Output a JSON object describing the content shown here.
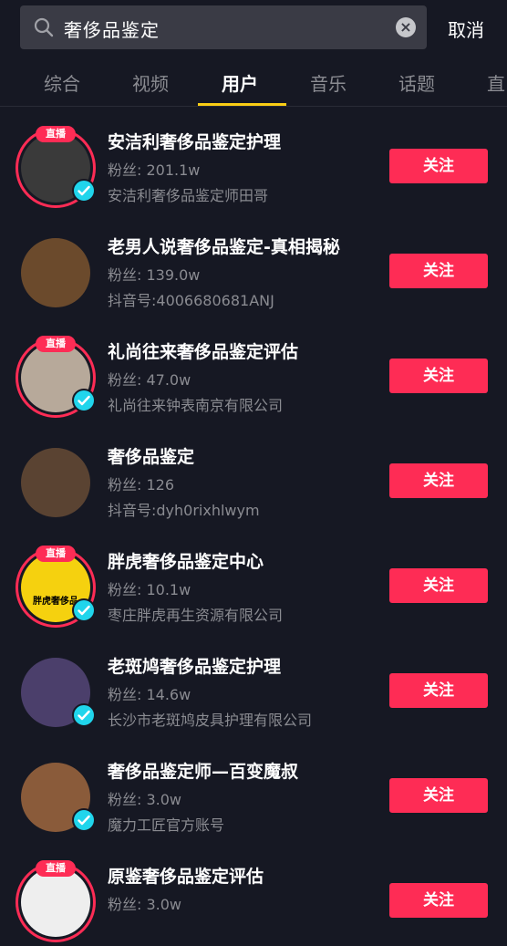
{
  "search": {
    "query": "奢侈品鉴定",
    "cancel_label": "取消"
  },
  "tabs": [
    {
      "label": "综合"
    },
    {
      "label": "视频"
    },
    {
      "label": "用户"
    },
    {
      "label": "音乐"
    },
    {
      "label": "话题"
    },
    {
      "label": "直"
    }
  ],
  "live_badge": "直播",
  "users": [
    {
      "name": "安洁利奢侈品鉴定护理",
      "fans": "粉丝: 201.1w",
      "desc": "安洁利奢侈品鉴定师田哥",
      "follow_label": "关注",
      "live": true,
      "verified": true,
      "avatar_color": "#3a3a3a"
    },
    {
      "name": "老男人说奢侈品鉴定-真相揭秘",
      "fans": "粉丝: 139.0w",
      "desc": "抖音号:4006680681ANJ",
      "follow_label": "关注",
      "live": false,
      "verified": false,
      "avatar_color": "#6b4a2c"
    },
    {
      "name": "礼尚往来奢侈品鉴定评估",
      "fans": "粉丝: 47.0w",
      "desc": "礼尚往来钟表南京有限公司",
      "follow_label": "关注",
      "live": true,
      "verified": true,
      "avatar_color": "#b7a99a"
    },
    {
      "name": "奢侈品鉴定",
      "fans": "粉丝: 126",
      "desc": "抖音号:dyh0rixhlwym",
      "follow_label": "关注",
      "live": false,
      "verified": false,
      "avatar_color": "#5a4332"
    },
    {
      "name": "胖虎奢侈品鉴定中心",
      "fans": "粉丝: 10.1w",
      "desc": "枣庄胖虎再生资源有限公司",
      "follow_label": "关注",
      "live": true,
      "verified": true,
      "avatar_color": "#f5d10f",
      "avatar_text": "胖虎奢侈品"
    },
    {
      "name": "老斑鸠奢侈品鉴定护理",
      "fans": "粉丝: 14.6w",
      "desc": "长沙市老斑鸠皮具护理有限公司",
      "follow_label": "关注",
      "live": false,
      "verified": true,
      "avatar_color": "#4b3f6b"
    },
    {
      "name": "奢侈品鉴定师—百变魔叔",
      "fans": "粉丝: 3.0w",
      "desc": "魔力工匠官方账号",
      "follow_label": "关注",
      "live": false,
      "verified": true,
      "avatar_color": "#8a5b3a"
    },
    {
      "name": "原鉴奢侈品鉴定评估",
      "fans": "粉丝: 3.0w",
      "desc": "",
      "follow_label": "关注",
      "live": true,
      "verified": false,
      "avatar_color": "#eeeeee"
    }
  ],
  "colors": {
    "background": "#161823",
    "accent": "#fe2c55",
    "verified": "#20d5ec",
    "tab_indicator": "#face15"
  }
}
